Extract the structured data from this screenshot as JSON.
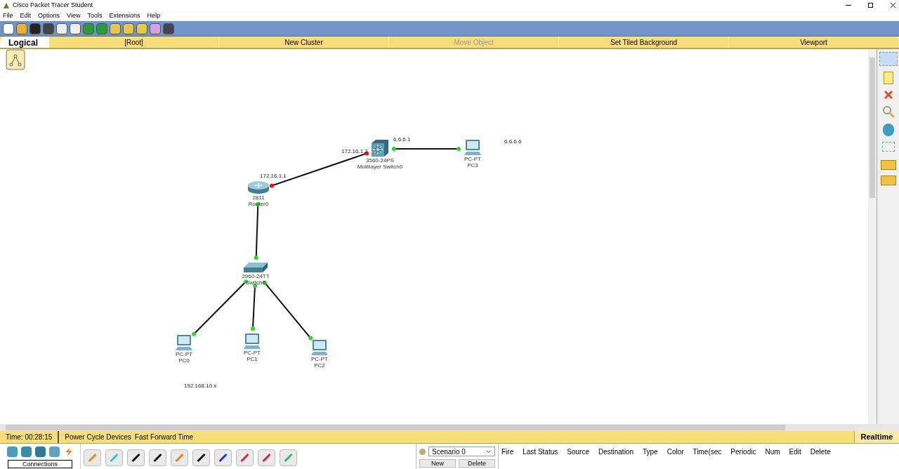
{
  "window": {
    "title": "Cisco Packet Tracer Student"
  },
  "menu": [
    "File",
    "Edit",
    "Options",
    "View",
    "Tools",
    "Extensions",
    "Help"
  ],
  "workspace_bar": [
    {
      "label": "Logical",
      "kind": "mode"
    },
    {
      "label": "[Root]",
      "kind": "item",
      "disabled": false
    },
    {
      "label": "New Cluster",
      "kind": "item",
      "disabled": false
    },
    {
      "label": "Move Object",
      "kind": "item",
      "disabled": true
    },
    {
      "label": "Set Tiled Background",
      "kind": "item",
      "disabled": false
    },
    {
      "label": "Viewport",
      "kind": "item",
      "disabled": false
    }
  ],
  "devices": [
    {
      "kind": "multilayer",
      "model": "3560-24PS",
      "name": "Multilayer Switch0"
    },
    {
      "kind": "pc",
      "model": "PC-PT",
      "name": "PC3"
    },
    {
      "kind": "router",
      "model": "2811",
      "name": "Router0"
    },
    {
      "kind": "switch",
      "model": "2960-24TT",
      "name": "Switch0"
    },
    {
      "kind": "pc",
      "model": "PC-PT",
      "name": "PC0"
    },
    {
      "kind": "pc",
      "model": "PC-PT",
      "name": "PC1"
    },
    {
      "kind": "pc",
      "model": "PC-PT",
      "name": "PC2"
    }
  ],
  "links": [
    {
      "end_a_up": false,
      "end_b_up": false
    },
    {
      "end_a_up": true,
      "end_b_up": true
    },
    {
      "end_a_up": true,
      "end_b_up": true
    },
    {
      "end_a_up": true,
      "end_b_up": true
    },
    {
      "end_a_up": true,
      "end_b_up": true
    },
    {
      "end_a_up": true,
      "end_b_up": true
    }
  ],
  "notes": [
    "172.16.1.2",
    "6.6.6.1",
    "172.16.1.1",
    "6.6.6.6",
    "192.168.10.x"
  ],
  "status_bar": {
    "time": "Time: 00:28:15",
    "buttons": [
      "Power Cycle Devices",
      "Fast Forward Time"
    ],
    "mode": "Realtime"
  },
  "device_panel": {
    "label": "Connections"
  },
  "scenario": {
    "value": "Scenario 0",
    "buttons": [
      "New",
      "Delete"
    ]
  },
  "pdu_columns": [
    "Fire",
    "Last Status",
    "Source",
    "Destination",
    "Type",
    "Color",
    "Time(sec",
    "Periodic",
    "Num",
    "Edit",
    "Delete"
  ]
}
